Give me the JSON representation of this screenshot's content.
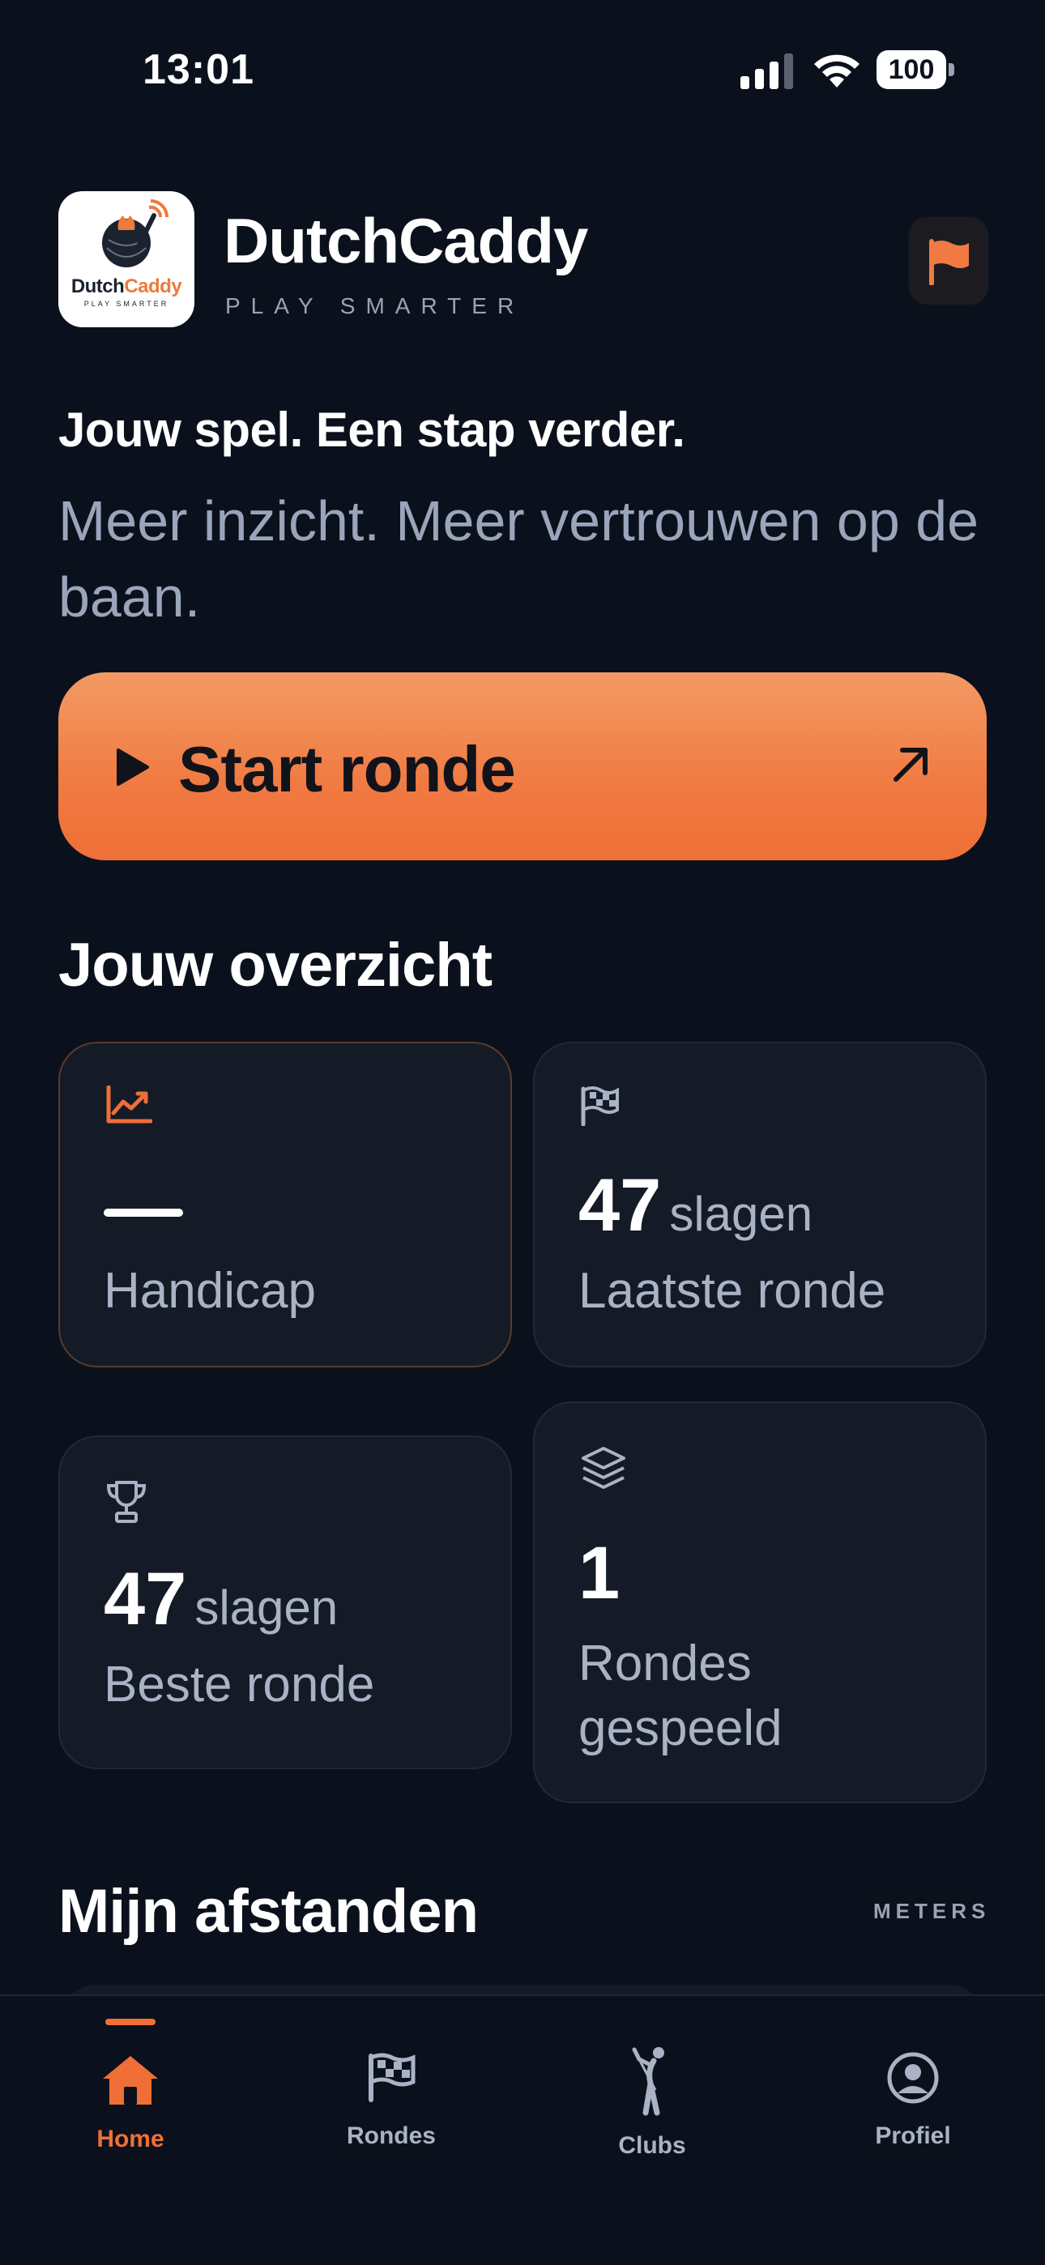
{
  "status_bar": {
    "time": "13:01",
    "battery": "100"
  },
  "header": {
    "logo_brand_a": "Dutch",
    "logo_brand_b": "Caddy",
    "logo_sub": "PLAY SMARTER",
    "title": "DutchCaddy",
    "tagline": "PLAY SMARTER"
  },
  "hero": {
    "title": "Jouw spel. Een stap verder.",
    "subtitle": "Meer inzicht. Meer vertrouwen op de baan."
  },
  "start_button": {
    "label": "Start ronde"
  },
  "overview": {
    "title": "Jouw overzicht",
    "cards": [
      {
        "value": "",
        "unit": "",
        "label": "Handicap",
        "icon": "chart-line-icon"
      },
      {
        "value": "47",
        "unit": "slagen",
        "label": "Laatste ronde",
        "icon": "checkered-flag-icon"
      },
      {
        "value": "47",
        "unit": "slagen",
        "label": "Beste ronde",
        "icon": "trophy-icon"
      },
      {
        "value": "1",
        "unit": "",
        "label_line1": "Rondes",
        "label_line2": "gespeeld",
        "icon": "layers-icon"
      }
    ]
  },
  "distances": {
    "title": "Mijn afstanden",
    "units": "METERS"
  },
  "tab_bar": {
    "tabs": [
      {
        "label": "Home",
        "icon": "home-icon",
        "active": true
      },
      {
        "label": "Rondes",
        "icon": "checkered-flag-icon",
        "active": false
      },
      {
        "label": "Clubs",
        "icon": "golfer-icon",
        "active": false
      },
      {
        "label": "Profiel",
        "icon": "profile-icon",
        "active": false
      }
    ]
  },
  "colors": {
    "background": "#0b111c",
    "card": "#141b27",
    "accent": "#ef6f37",
    "muted_text": "#aab3c6"
  }
}
